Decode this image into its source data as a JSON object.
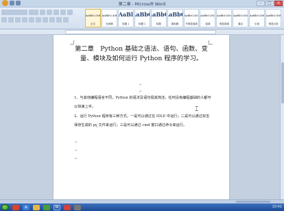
{
  "window": {
    "title": "第二章 - Microsoft Word"
  },
  "styles_gallery": [
    {
      "sample": "AaBbCcDd",
      "name": "正文",
      "selected": true
    },
    {
      "sample": "AaBbCcDd",
      "name": "无间隔"
    },
    {
      "sample": "AaBl",
      "name": "标题 1",
      "big": true
    },
    {
      "sample": "AaBbC",
      "name": "标题 2",
      "big": true
    },
    {
      "sample": "AaBbC",
      "name": "标题",
      "big": true
    },
    {
      "sample": "AaBbC",
      "name": "副标题",
      "big": true
    },
    {
      "sample": "AaBbCcDd",
      "name": "不明显强调"
    },
    {
      "sample": "AaBbCcDd",
      "name": "强调"
    },
    {
      "sample": "AaBbCcDd",
      "name": "明显强调"
    },
    {
      "sample": "AaBbCcDd",
      "name": "要点"
    },
    {
      "sample": "AaBbCcDd",
      "name": "引用"
    },
    {
      "sample": "AaBbCcDd",
      "name": "明显引用"
    }
  ],
  "document": {
    "title": "第二章　Python 基础之语法、语句、函数、变量、模块及如何运行 Python 程序的学习。",
    "para1": "1、与其他编程语言不同，Python 的语法及语句极其简洁，任何没有编程基础的人都可以快速上手。",
    "para2_a": "2、运行 Python 程序有三种方式，一是可以通过在 IDLE 中运行；二是可以通过双击保存生成的 ",
    "para2_u": "py",
    "para2_b": " 文件来运行；三是可以通过 cmd 窗口通过命令来运行。"
  },
  "taskbar": {
    "time": "10:42"
  }
}
